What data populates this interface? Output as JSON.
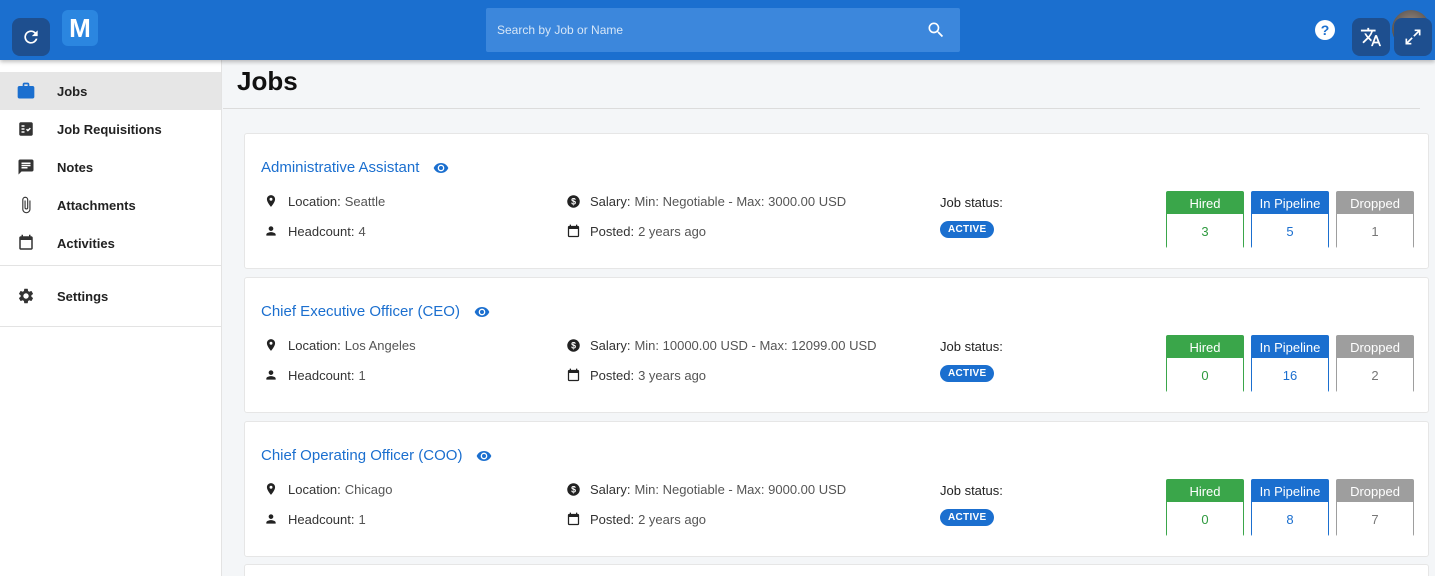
{
  "header": {
    "logo_letter": "M",
    "search_placeholder": "Search by Job or Name",
    "help_label": "?"
  },
  "sidebar": {
    "items": [
      {
        "label": "Jobs",
        "icon": "briefcase-icon",
        "active": true
      },
      {
        "label": "Job Requisitions",
        "icon": "checklist-icon"
      },
      {
        "label": "Notes",
        "icon": "note-icon"
      },
      {
        "label": "Attachments",
        "icon": "paperclip-icon"
      },
      {
        "label": "Activities",
        "icon": "calendar-icon"
      }
    ],
    "settings_label": "Settings"
  },
  "page": {
    "title": "Jobs"
  },
  "labels": {
    "location": "Location:",
    "headcount": "Headcount:",
    "salary": "Salary:",
    "posted": "Posted:",
    "job_status": "Job status:",
    "hired": "Hired",
    "in_pipeline": "In Pipeline",
    "dropped": "Dropped"
  },
  "jobs": [
    {
      "title": "Administrative Assistant",
      "location": "Seattle",
      "headcount": "4",
      "salary": "Min: Negotiable - Max: 3000.00 USD",
      "posted": "2 years ago",
      "status": "ACTIVE",
      "hired": "3",
      "in_pipeline": "5",
      "dropped": "1"
    },
    {
      "title": "Chief Executive Officer (CEO)",
      "location": "Los Angeles",
      "headcount": "1",
      "salary": "Min: 10000.00 USD - Max: 12099.00 USD",
      "posted": "3 years ago",
      "status": "ACTIVE",
      "hired": "0",
      "in_pipeline": "16",
      "dropped": "2"
    },
    {
      "title": "Chief Operating Officer (COO)",
      "location": "Chicago",
      "headcount": "1",
      "salary": "Min: Negotiable - Max: 9000.00 USD",
      "posted": "2 years ago",
      "status": "ACTIVE",
      "hired": "0",
      "in_pipeline": "8",
      "dropped": "7"
    }
  ],
  "colors": {
    "primary": "#1b6fcf",
    "hired": "#3aa64a",
    "dropped": "#9e9e9e"
  }
}
